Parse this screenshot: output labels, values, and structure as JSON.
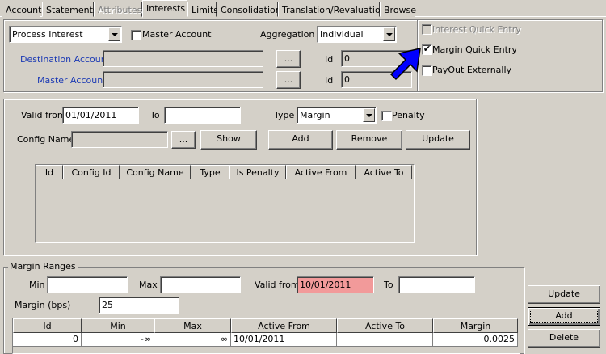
{
  "tabs": [
    {
      "label": "Account"
    },
    {
      "label": "Statements"
    },
    {
      "label": "Attributes"
    },
    {
      "label": "Interests"
    },
    {
      "label": "Limits"
    },
    {
      "label": "Consolidation"
    },
    {
      "label": "Translation/Revaluation"
    },
    {
      "label": "Browse"
    }
  ],
  "top": {
    "process_combo": "Process Interest",
    "master_account_check_label": "Master Account",
    "aggregation_label": "Aggregation",
    "aggregation_value": "Individual",
    "destination_account_label": "Destination Account",
    "master_account_label": "Master Account",
    "browse_label": "...",
    "id_label": "Id",
    "dest_id": "0",
    "master_id": "0",
    "interest_quick_entry_label": "Interest Quick Entry",
    "margin_quick_entry_label": "Margin Quick Entry",
    "margin_quick_entry_checked": "✔",
    "payout_externally_label": "PayOut Externally"
  },
  "config": {
    "valid_from_label": "Valid from",
    "valid_from_value": "01/01/2011",
    "to_label": "To",
    "to_value": "",
    "type_label": "Type",
    "type_value": "Margin",
    "penalty_label": "Penalty",
    "config_name_label": "Config Name",
    "browse_label": "...",
    "show_label": "Show",
    "add_label": "Add",
    "remove_label": "Remove",
    "update_label": "Update",
    "columns": [
      "Id",
      "Config Id",
      "Config Name",
      "Type",
      "Is Penalty",
      "Active From",
      "Active To"
    ]
  },
  "margin": {
    "group_label": "Margin Ranges",
    "min_label": "Min",
    "max_label": "Max",
    "valid_from_label": "Valid from",
    "valid_from_value": "10/01/2011",
    "to_label": "To",
    "margin_bps_label": "Margin (bps)",
    "margin_bps_value": "25",
    "columns": [
      "Id",
      "Min",
      "Max",
      "Active From",
      "Active To",
      "Margin"
    ],
    "rows": [
      {
        "id": "0",
        "min": "-∞",
        "max": "∞",
        "active_from": "10/01/2011",
        "active_to": "",
        "margin": "0.0025"
      }
    ],
    "update_label": "Update",
    "add_label": "Add",
    "delete_label": "Delete"
  },
  "colors": {
    "arrow": "#0000ff",
    "invalid_field": "#f29a9a",
    "link_label": "#1c3ab4"
  }
}
